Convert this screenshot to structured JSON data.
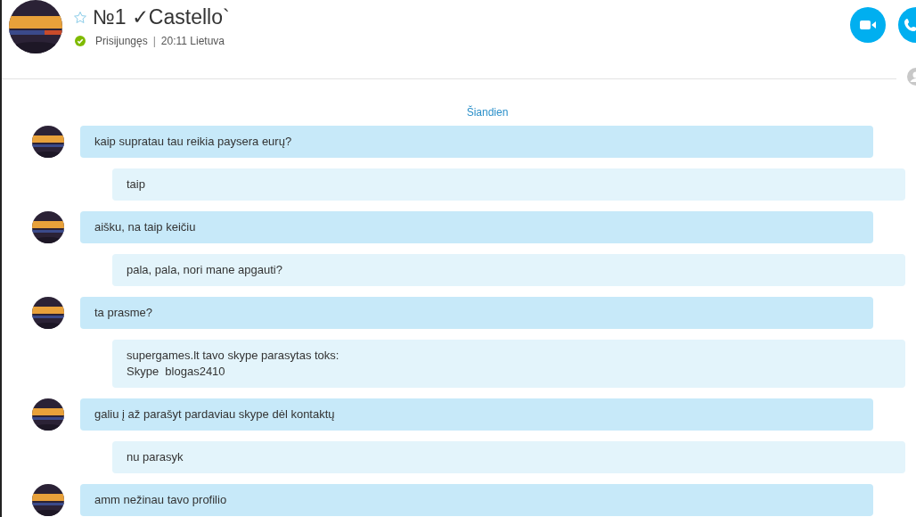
{
  "contact": {
    "name": "№1 ✓Castello`",
    "favorite": false,
    "status": "Prisijungęs",
    "separator": "|",
    "local_time": "20:11 Lietuva",
    "online": true
  },
  "chat": {
    "date": "Šiandien",
    "messages": [
      {
        "kind": "in",
        "text": "kaip supratau tau reikia paysera eurų?"
      },
      {
        "kind": "out",
        "text": "taip"
      },
      {
        "kind": "in",
        "text": "aišku, na taip keičiu"
      },
      {
        "kind": "out",
        "text": "pala, pala, nori mane apgauti?"
      },
      {
        "kind": "in",
        "text": "ta prasme?"
      },
      {
        "kind": "out",
        "text": "supergames.lt tavo skype parasytas toks:\nSkype  blogas2410"
      },
      {
        "kind": "in",
        "text": "galiu į až parašyt pardaviau skype dėl kontaktų"
      },
      {
        "kind": "out",
        "text": "nu parasyk"
      },
      {
        "kind": "in",
        "text": "amm nežinau tavo profilio"
      }
    ]
  }
}
